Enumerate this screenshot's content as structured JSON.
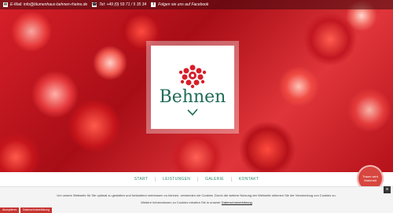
{
  "topbar": {
    "email": "E-Mail: info@blumenhaus-behnen-rheine.de",
    "phone": "Tel: +49 (0) 59 71 / 5 35 34",
    "facebook": "Folgen sie uns auf Facebook"
  },
  "logo": {
    "text": "Behnen"
  },
  "nav": {
    "items": [
      "START",
      "LEISTUNGEN",
      "GALERIE",
      "KONTAKT"
    ]
  },
  "badge": {
    "text": "Traum wird Wahrheit"
  },
  "cookie": {
    "line1": "Um unsere Webseite für Sie optimal zu gestalten und fortlaufend verbessern zu können, verwenden wir Cookies. Durch die weitere Nutzung der Webseite stimmen Sie der Verwendung von Cookies zu.",
    "line2_prefix": "Weitere Informationen zu Cookies erhalten Sie in unserer ",
    "line2_link": "Datenschutzerklärung",
    "close": "×",
    "button_accept": "Akzeptieren",
    "button_privacy": "Datenschutzerklärung"
  },
  "colors": {
    "accent": "#2e8a6a",
    "brand_red": "#c7342f",
    "logo_green": "#1f6b55"
  }
}
